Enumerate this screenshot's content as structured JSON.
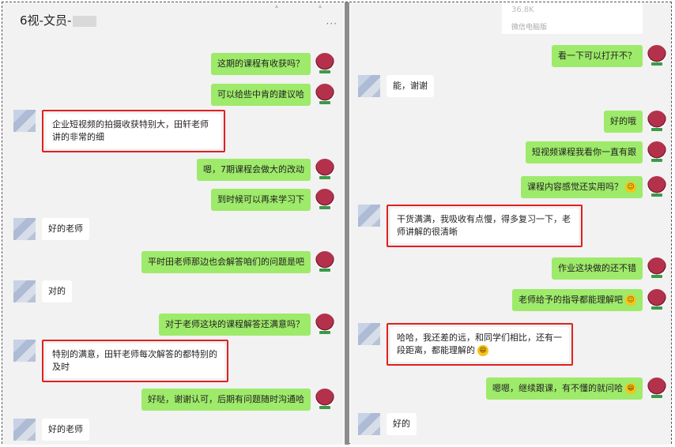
{
  "left": {
    "title": "6视-文员-",
    "menu": "···",
    "messages": [
      {
        "from": "me",
        "text": "这期的课程有收获吗？"
      },
      {
        "from": "me",
        "text": "可以给些中肯的建议哈"
      },
      {
        "from": "other",
        "text": "企业短视频的拍摄收获特别大，田轩老师讲的非常的细",
        "highlight": true
      },
      {
        "from": "me",
        "text": "嗯，7期课程会做大的改动"
      },
      {
        "from": "me",
        "text": "到时候可以再来学习下"
      },
      {
        "from": "other",
        "text": "好的老师"
      },
      {
        "from": "me",
        "text": "平时田老师那边也会解答咱们的问题是吧"
      },
      {
        "from": "other",
        "text": "对的"
      },
      {
        "from": "me",
        "text": "对于老师这块的课程解答还满意吗？"
      },
      {
        "from": "other",
        "text": "特别的满意，田轩老师每次解答的都特别的及时",
        "highlight": true
      },
      {
        "from": "me",
        "text": "好哒，谢谢认可，后期有问题随时沟通哈"
      },
      {
        "from": "other",
        "text": "好的老师"
      }
    ]
  },
  "right": {
    "file_card": {
      "size": "36.8K",
      "source": "微信电脑版"
    },
    "messages": [
      {
        "from": "me",
        "text": "看一下可以打开不？"
      },
      {
        "from": "other",
        "text": "能，谢谢"
      },
      {
        "from": "me",
        "text": "好的哦"
      },
      {
        "from": "me",
        "text": "短视频课程我看你一直有跟"
      },
      {
        "from": "me",
        "text": "课程内容感觉还实用吗？",
        "emoji": "wink"
      },
      {
        "from": "other",
        "text": "干货满满，我吸收有点慢，得多复习一下，老师讲解的很清晰",
        "highlight": true
      },
      {
        "from": "me",
        "text": "作业这块做的还不错"
      },
      {
        "from": "me",
        "text": "老师给予的指导都能理解吧",
        "emoji": "wink"
      },
      {
        "from": "other",
        "text": "哈哈，我还差的远，和同学们相比，还有一段距离，都能理解的",
        "highlight": true,
        "emoji": "grin"
      },
      {
        "from": "me",
        "text": "嗯嗯，继续跟课，有不懂的就问哈",
        "emoji": "grin"
      },
      {
        "from": "other",
        "text": "好的"
      }
    ]
  }
}
